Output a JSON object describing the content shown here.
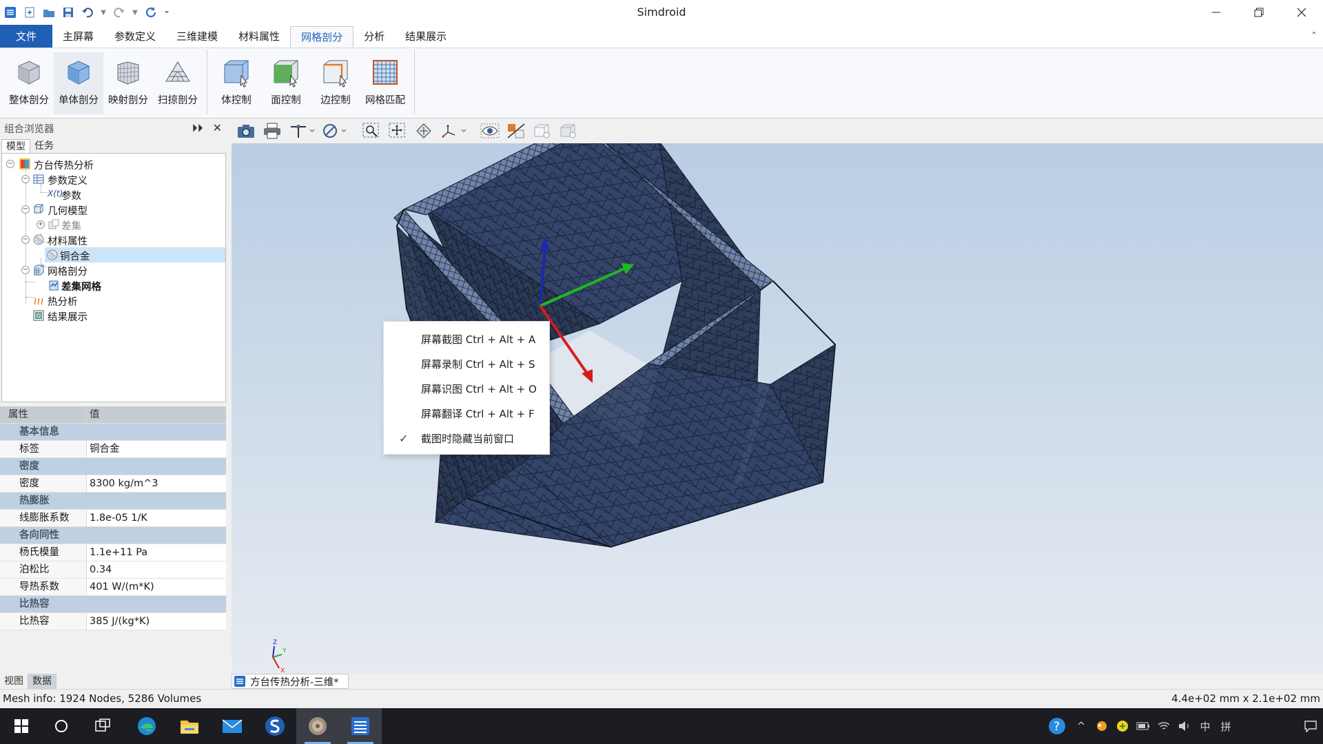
{
  "app": {
    "title": "Simdroid"
  },
  "menu": {
    "tabs": [
      "文件",
      "主屏幕",
      "参数定义",
      "三维建模",
      "材料属性",
      "网格剖分",
      "分析",
      "结果展示"
    ],
    "active_index": 5
  },
  "ribbon": {
    "group1": [
      {
        "label": "整体剖分",
        "icon": "cube-mesh-icon"
      },
      {
        "label": "单体剖分",
        "icon": "single-body-mesh-icon"
      },
      {
        "label": "映射剖分",
        "icon": "mapped-mesh-icon"
      },
      {
        "label": "扫掠剖分",
        "icon": "sweep-mesh-icon"
      }
    ],
    "group2": [
      {
        "label": "体控制",
        "icon": "volume-control-icon"
      },
      {
        "label": "面控制",
        "icon": "face-control-icon"
      },
      {
        "label": "边控制",
        "icon": "edge-control-icon"
      },
      {
        "label": "网格匹配",
        "icon": "mesh-match-icon"
      }
    ]
  },
  "browser": {
    "title": "组合浏览器",
    "tabs": [
      "模型",
      "任务"
    ],
    "tree": {
      "root": "方台传热分析",
      "param_def": "参数定义",
      "param": "参数",
      "geometry": "几何模型",
      "difference": "差集",
      "material": "材料属性",
      "copper": "铜合金",
      "mesh": "网格剖分",
      "diff_mesh": "差集网格",
      "thermal": "热分析",
      "results": "结果展示"
    }
  },
  "properties": {
    "headers": [
      "属性",
      "值"
    ],
    "rows": [
      {
        "type": "group",
        "key": "基本信息"
      },
      {
        "type": "item",
        "key": "标签",
        "value": "铜合金"
      },
      {
        "type": "group",
        "key": "密度"
      },
      {
        "type": "item",
        "key": "密度",
        "value": "8300 kg/m^3"
      },
      {
        "type": "group",
        "key": "热膨胀"
      },
      {
        "type": "item",
        "key": "线膨胀系数",
        "value": "1.8e-05 1/K"
      },
      {
        "type": "group",
        "key": "各向同性"
      },
      {
        "type": "item",
        "key": "杨氏模量",
        "value": "1.1e+11 Pa"
      },
      {
        "type": "item",
        "key": "泊松比",
        "value": "0.34"
      },
      {
        "type": "item",
        "key": "导热系数",
        "value": "401 W/(m*K)"
      },
      {
        "type": "group",
        "key": "比热容"
      },
      {
        "type": "item",
        "key": "比热容",
        "value": "385 J/(kg*K)"
      }
    ],
    "tabs": [
      "视图",
      "数据"
    ]
  },
  "context_menu": {
    "items": [
      {
        "label": "屏幕截图 Ctrl + Alt + A",
        "checked": false
      },
      {
        "label": "屏幕录制 Ctrl + Alt + S",
        "checked": false
      },
      {
        "label": "屏幕识图 Ctrl + Alt + O",
        "checked": false
      },
      {
        "label": "屏幕翻译 Ctrl + Alt + F",
        "checked": false
      },
      {
        "label": "截图时隐藏当前窗口",
        "checked": true
      }
    ]
  },
  "viewport": {
    "doc_tab": "方台传热分析-三维*",
    "triad": {
      "x": "X",
      "y": "Y",
      "z": "Z"
    },
    "mesh_color": "#2b3a55",
    "axis_colors": {
      "x": "#e02020",
      "y": "#22c022",
      "z": "#2030c0"
    }
  },
  "status": {
    "mesh_info": "Mesh info: 1924 Nodes, 5286 Volumes",
    "dimensions": "4.4e+02 mm x 2.1e+02 mm"
  },
  "taskbar": {
    "tray": {
      "ime": "中",
      "ime2": "拼"
    }
  }
}
